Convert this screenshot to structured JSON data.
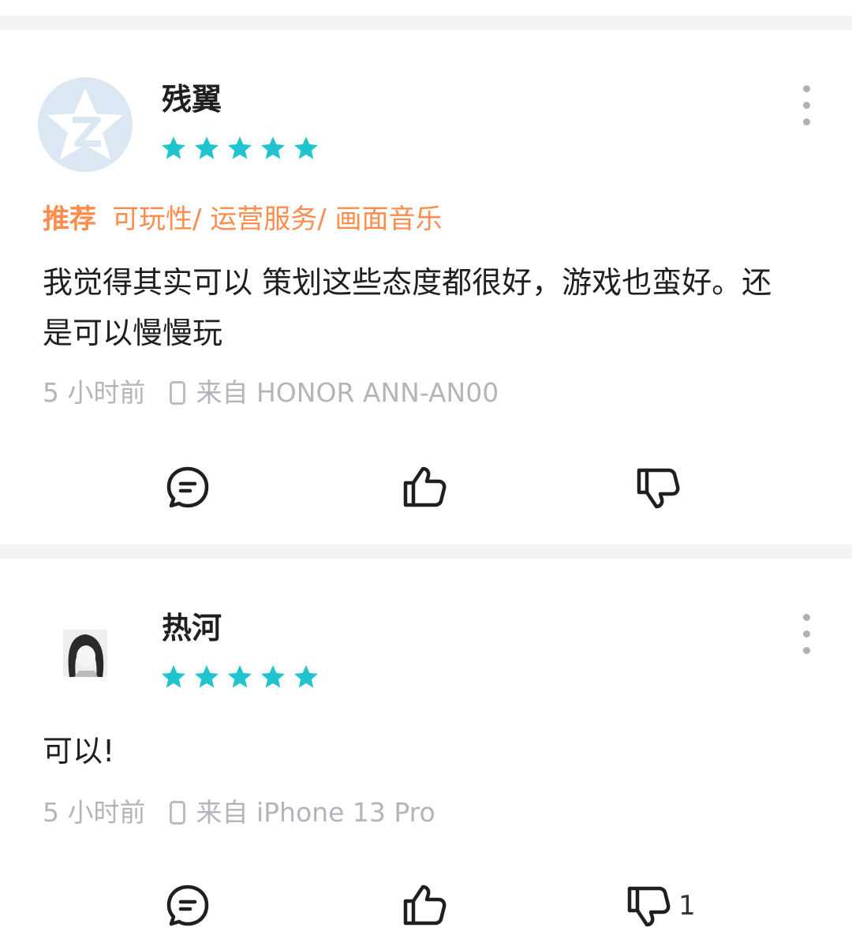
{
  "reviews": [
    {
      "username": "残翼",
      "rating": 5,
      "avatar_icon": "qq-zone-star-icon",
      "tags": {
        "recommend_label": "推荐",
        "aspects": "可玩性/ 运营服务/ 画面音乐"
      },
      "text": "我觉得其实可以 策划这些态度都很好，游戏也蛮好。还是可以慢慢玩",
      "time": "5 小时前",
      "device": "来自 HONOR ANN-AN00",
      "dislike_count": ""
    },
    {
      "username": "热河",
      "rating": 5,
      "avatar_icon": "anime-girl-avatar",
      "text": "可以!",
      "time": "5 小时前",
      "device": "来自 iPhone 13 Pro",
      "dislike_count": "1"
    }
  ],
  "colors": {
    "star": "#1fc4cf",
    "tag": "#ff8c4c",
    "meta": "#b2b5ba",
    "text": "#1f1f1f",
    "divider": "#f2f3f5"
  },
  "icons": [
    "qq-zone-star-icon",
    "star-icon",
    "more-vertical-icon",
    "phone-icon",
    "comment-icon",
    "thumbs-up-icon",
    "thumbs-down-icon"
  ]
}
